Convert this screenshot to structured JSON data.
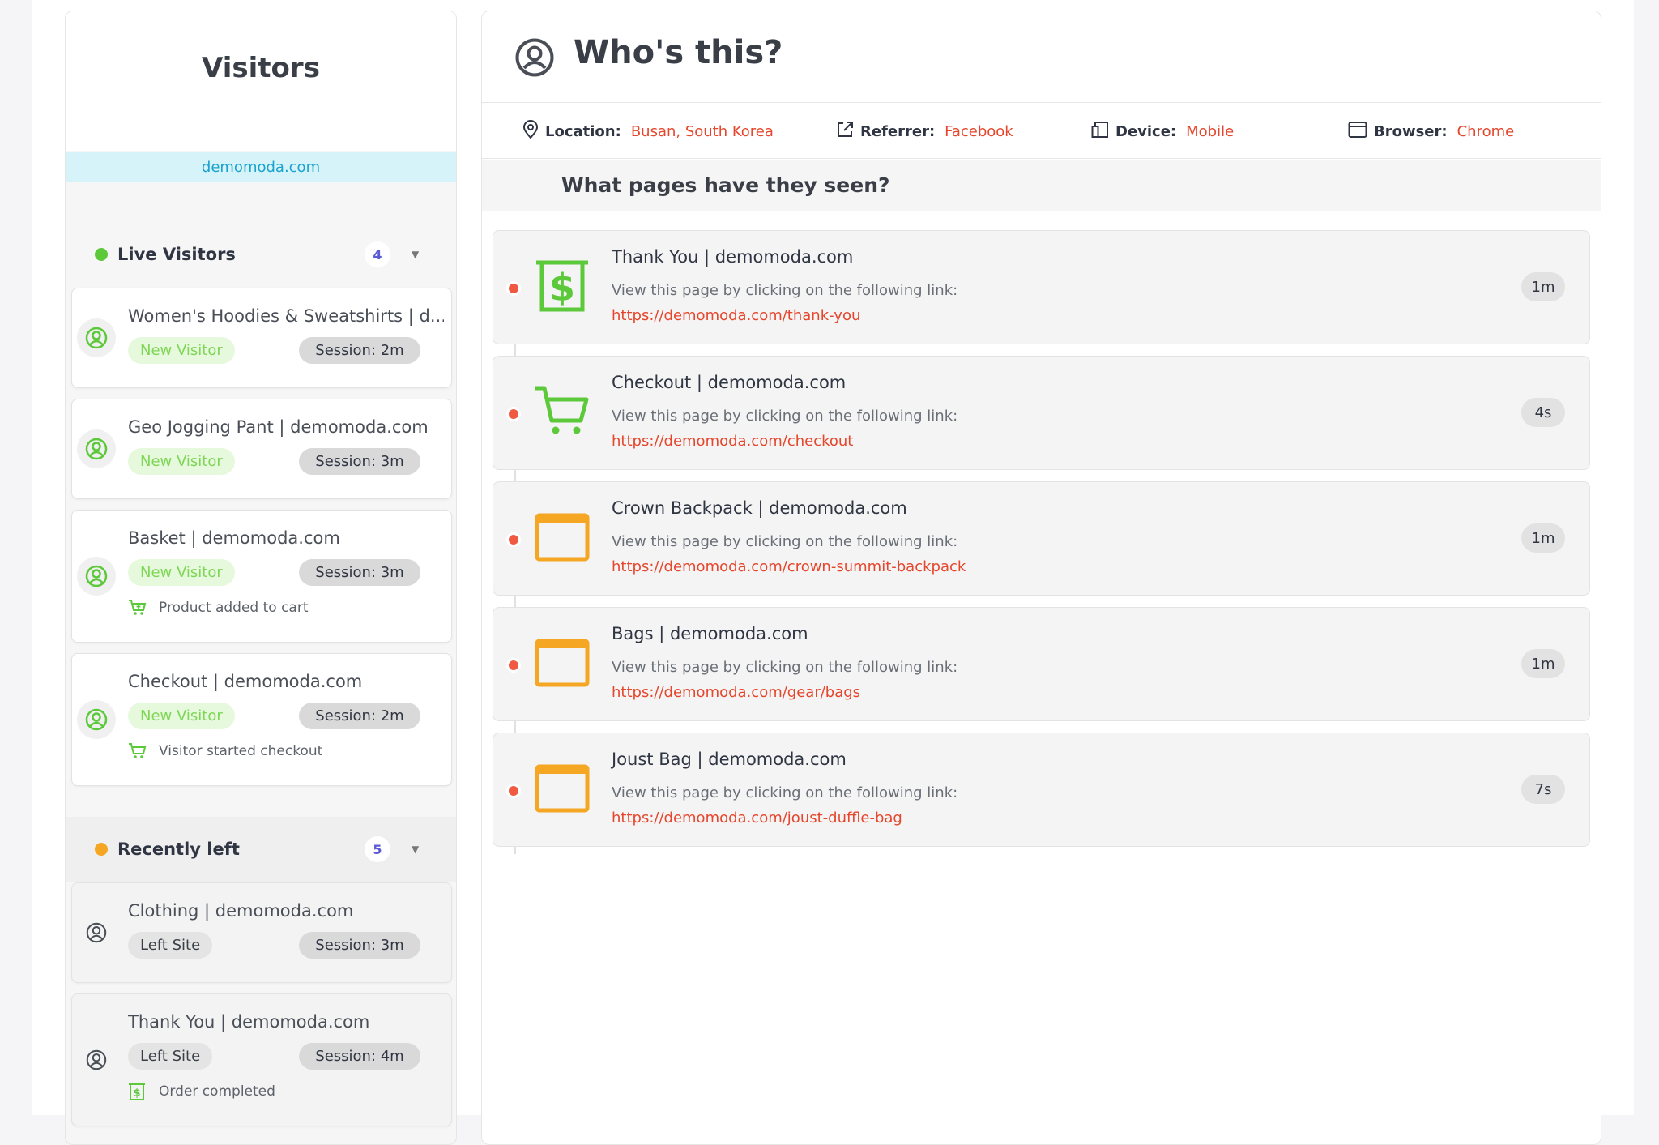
{
  "visitors_panel": {
    "title": "Visitors",
    "domain": "demomoda.com",
    "live": {
      "label": "Live Visitors",
      "count": "4",
      "color": "#5cc93a",
      "items": [
        {
          "title": "Women's Hoodies & Sweatshirts | d...",
          "badge": "New Visitor",
          "session": "Session: 2m",
          "event": ""
        },
        {
          "title": "Geo Jogging Pant | demomoda.com",
          "badge": "New Visitor",
          "session": "Session: 3m",
          "event": ""
        },
        {
          "title": "Basket | demomoda.com",
          "badge": "New Visitor",
          "session": "Session: 3m",
          "event": "Product added to cart"
        },
        {
          "title": "Checkout | demomoda.com",
          "badge": "New Visitor",
          "session": "Session: 2m",
          "event": "Visitor started checkout"
        }
      ]
    },
    "recent": {
      "label": "Recently left",
      "count": "5",
      "color": "#f5a623",
      "items": [
        {
          "title": "Clothing | demomoda.com",
          "badge": "Left Site",
          "session": "Session: 3m",
          "event": ""
        },
        {
          "title": "Thank You | demomoda.com",
          "badge": "Left Site",
          "session": "Session: 4m",
          "event": "Order completed"
        }
      ]
    }
  },
  "detail": {
    "title": "Who's this?",
    "info": {
      "location_label": "Location:",
      "location": "Busan, South Korea",
      "referrer_label": "Referrer:",
      "referrer": "Facebook",
      "device_label": "Device:",
      "device": "Mobile",
      "browser_label": "Browser:",
      "browser": "Chrome"
    },
    "pages_heading": "What pages have they seen?",
    "pages": [
      {
        "title": "Thank You | demomoda.com",
        "desc": "View this page by clicking on the following link:",
        "link": "https://demomoda.com/thank-you",
        "time": "1m",
        "icon": "dollar-receipt-icon"
      },
      {
        "title": "Checkout | demomoda.com",
        "desc": "View this page by clicking on the following link:",
        "link": "https://demomoda.com/checkout",
        "time": "4s",
        "icon": "cart-icon"
      },
      {
        "title": "Crown Backpack | demomoda.com",
        "desc": "View this page by clicking on the following link:",
        "link": "https://demomoda.com/crown-summit-backpack",
        "time": "1m",
        "icon": "browser-window-icon"
      },
      {
        "title": "Bags | demomoda.com",
        "desc": "View this page by clicking on the following link:",
        "link": "https://demomoda.com/gear/bags",
        "time": "1m",
        "icon": "browser-window-icon"
      },
      {
        "title": "Joust Bag | demomoda.com",
        "desc": "View this page by clicking on the following link:",
        "link": "https://demomoda.com/joust-duffle-bag",
        "time": "7s",
        "icon": "browser-window-icon"
      }
    ]
  },
  "colors": {
    "accent_red": "#e5462c",
    "green": "#5cc93a",
    "orange": "#f5a623",
    "domain_bg": "#d6f3fa",
    "domain_text": "#1aa3cc"
  }
}
